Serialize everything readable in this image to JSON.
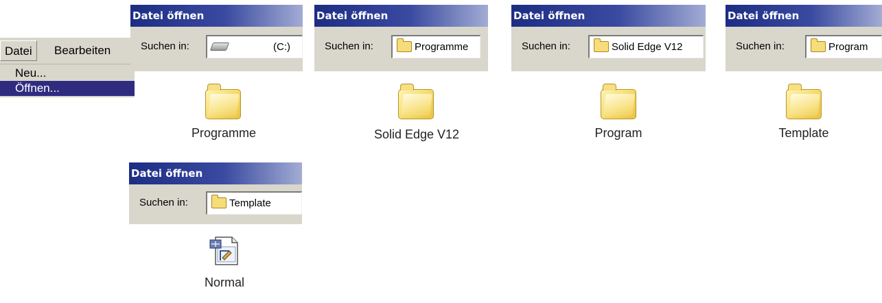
{
  "menu": {
    "file_label": "Datei",
    "edit_label": "Bearbeiten",
    "items": [
      "Neu...",
      "Öffnen..."
    ],
    "highlight_color": "#2f2c80"
  },
  "dialogs": [
    {
      "title": "Datei öffnen",
      "look_in_label": "Suchen in:",
      "location": "(C:)",
      "location_icon": "drive-icon",
      "result_label": "Programme",
      "result_icon": "folder-icon"
    },
    {
      "title": "Datei öffnen",
      "look_in_label": "Suchen in:",
      "location": "Programme",
      "location_icon": "folder-icon",
      "result_label": "Solid Edge V12",
      "result_icon": "folder-icon"
    },
    {
      "title": "Datei öffnen",
      "look_in_label": "Suchen in:",
      "location": "Solid Edge V12",
      "location_icon": "folder-icon",
      "result_label": "Program",
      "result_icon": "folder-icon"
    },
    {
      "title": "Datei öffnen",
      "look_in_label": "Suchen in:",
      "location": "Program",
      "location_icon": "folder-icon",
      "result_label": "Template",
      "result_icon": "folder-icon"
    },
    {
      "title": "Datei öffnen",
      "look_in_label": "Suchen in:",
      "location": "Template",
      "location_icon": "folder-icon",
      "result_label": "Normal",
      "result_icon": "template-document-icon"
    }
  ],
  "colors": {
    "titlebar": "#1c2d84",
    "dialog_face": "#d9d6cc"
  }
}
